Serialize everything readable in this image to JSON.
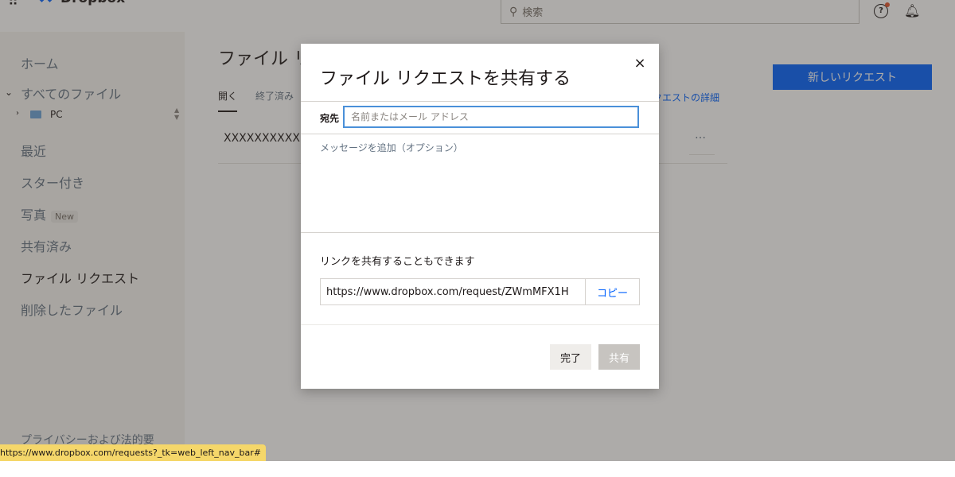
{
  "app": {
    "logo_text": "Dropbox",
    "grid_glyph": "⠿",
    "accent_color": "#0061fe"
  },
  "search": {
    "placeholder": "検索",
    "icon": "search-icon"
  },
  "header": {
    "help_icon": "help-icon",
    "notifications_icon": "bell-icon"
  },
  "sidebar": {
    "items": [
      {
        "label": "ホーム"
      },
      {
        "label": "すべてのファイル"
      },
      {
        "label": "最近"
      },
      {
        "label": "スター付き"
      },
      {
        "label": "写真"
      },
      {
        "label": "共有済み"
      },
      {
        "label": "ファイル リクエスト"
      },
      {
        "label": "削除したファイル"
      }
    ],
    "photos_badge": "New",
    "tree": {
      "folder_label": "PC"
    },
    "privacy": "プライバシーおよび法的要"
  },
  "main": {
    "title": "ファイル リ",
    "tabs": [
      {
        "label": "開く"
      },
      {
        "label": "終了済み"
      }
    ],
    "row_text": "XXXXXXXXXX",
    "detail_link": "クエストの詳細",
    "more_label": "…",
    "new_request_label": "新しいリクエスト"
  },
  "modal": {
    "title": "ファイル リクエストを共有する",
    "close_label": "×",
    "to_label": "宛先",
    "to_placeholder": "名前またはメール アドレス",
    "message_placeholder": "メッセージを追加（オプション）",
    "link_label": "リンクを共有することもできます",
    "link_value": "https://www.dropbox.com/request/ZWmMFX1H",
    "copy_label": "コピー",
    "done_label": "完了",
    "share_label": "共有"
  },
  "status_bar": {
    "url": "https://www.dropbox.com/requests?_tk=web_left_nav_bar#"
  }
}
